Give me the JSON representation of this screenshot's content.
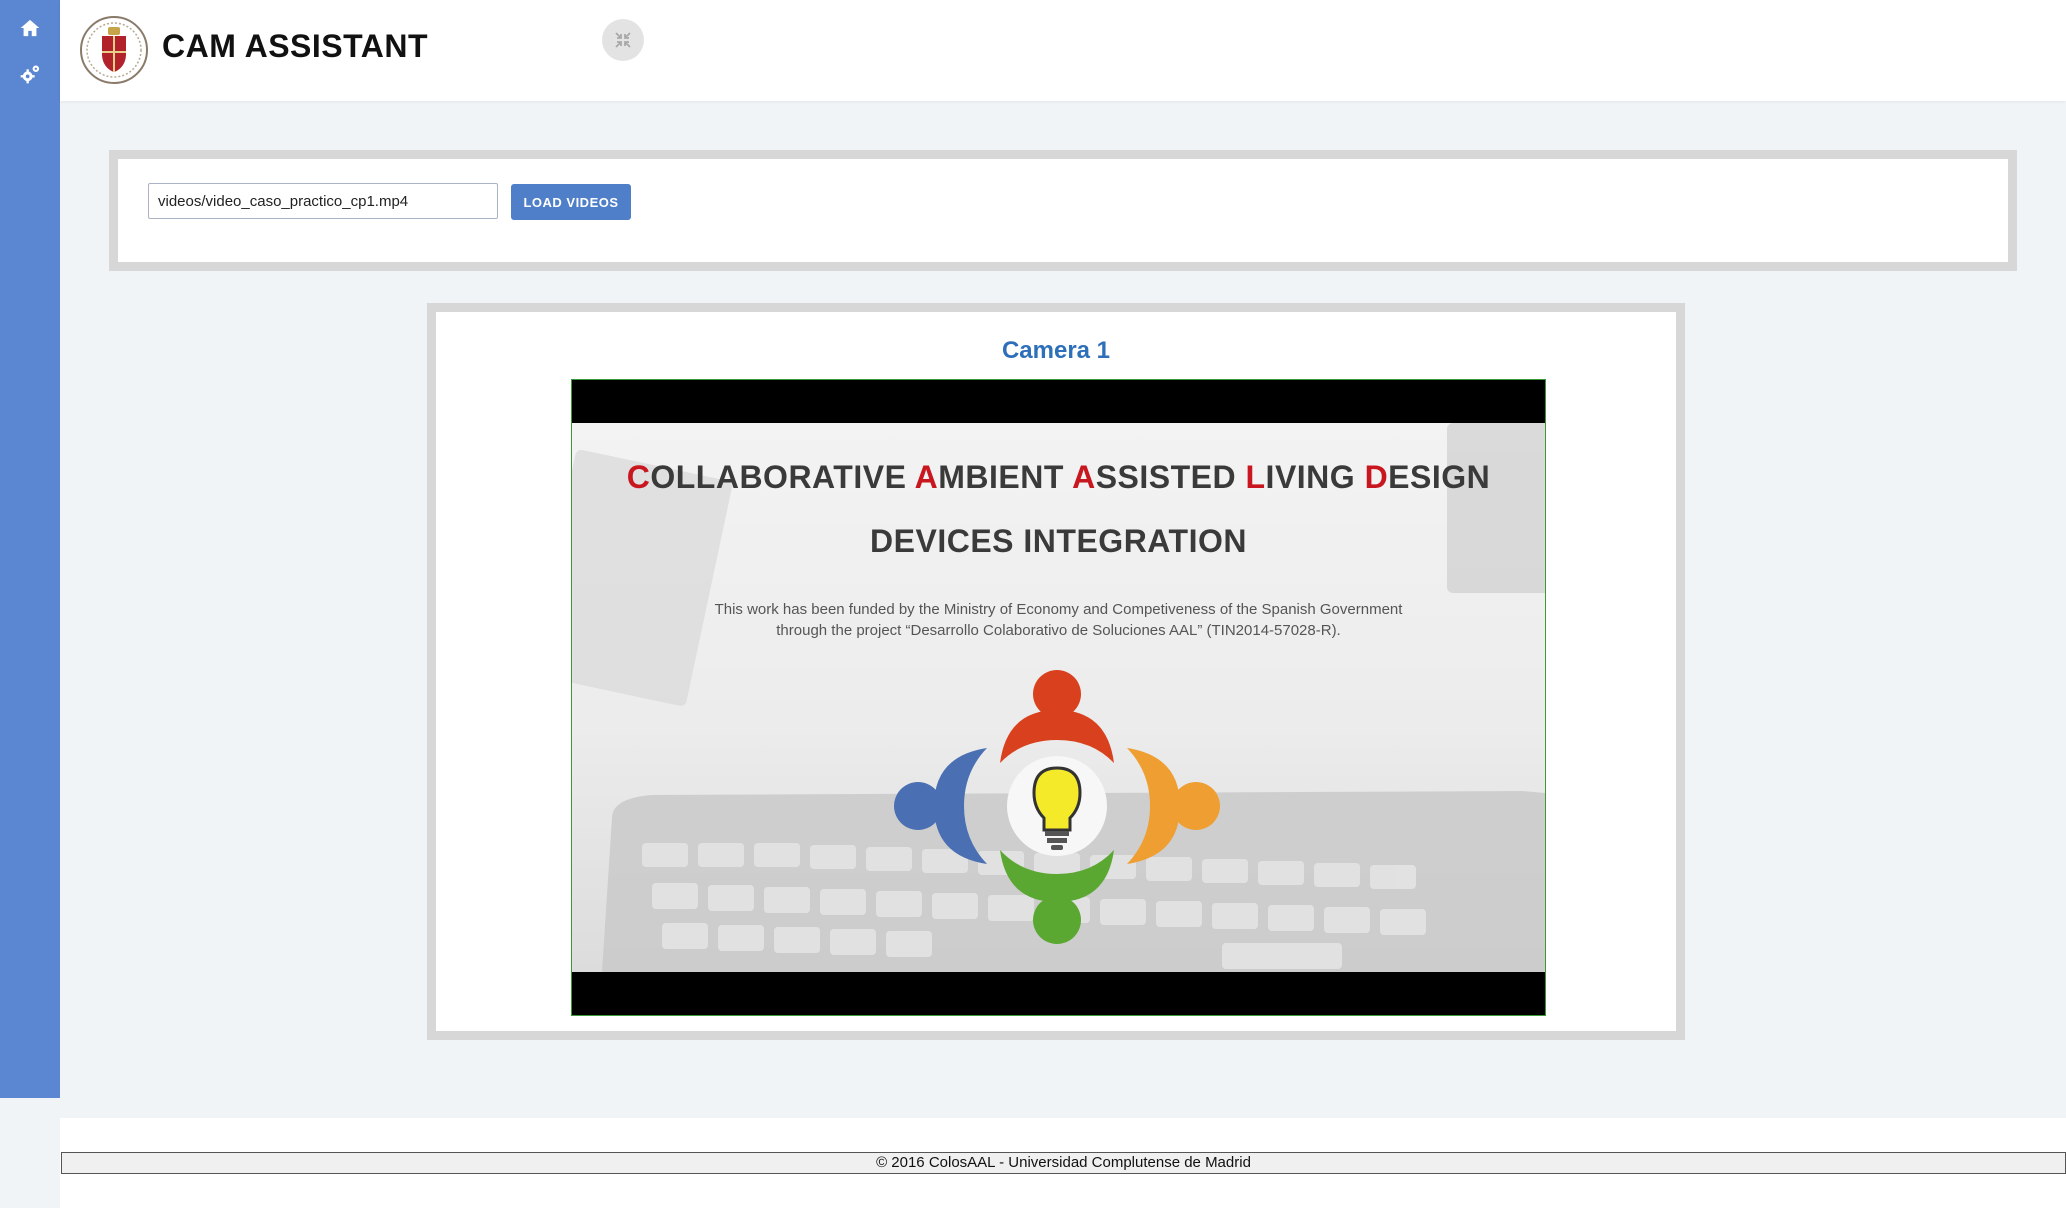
{
  "header": {
    "title": "CAM ASSISTANT"
  },
  "icons": {
    "home": "home-icon",
    "settings": "gears-icon",
    "logo": "university-crest-logo",
    "fullscreen": "collapse-icon"
  },
  "loader": {
    "path_value": "videos/video_caso_practico_cp1.mp4",
    "button_label": "LOAD VIDEOS"
  },
  "camera": {
    "title": "Camera 1",
    "frame": {
      "title_line1_parts": [
        "C",
        "OLLABORATIVE ",
        "A",
        "MBIENT ",
        "A",
        "SSISTED ",
        "L",
        "IVING ",
        "D",
        "ESIGN"
      ],
      "title_line2": "DEVICES INTEGRATION",
      "credit_line1": "This work has been funded by the Ministry of Economy and Competiveness of the Spanish Government",
      "credit_line2": "through the project “Desarrollo Colaborativo de Soluciones AAL” (TIN2014-57028-R)."
    }
  },
  "footer": {
    "text": "© 2016 ColosAAL - Universidad Complutense de Madrid"
  },
  "colors": {
    "sidebar": "#5b86d1",
    "accent": "#4f7fc9",
    "camera_title": "#2e6fba",
    "highlight_letter": "#c8171e"
  }
}
